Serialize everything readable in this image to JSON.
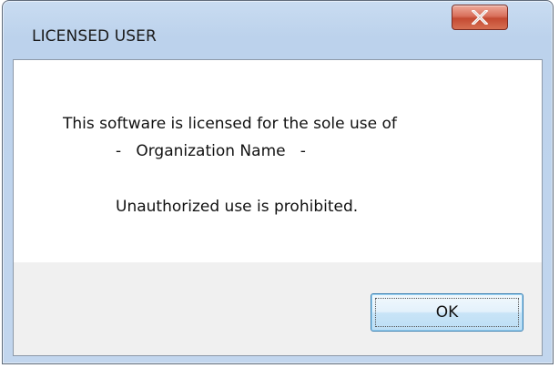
{
  "window": {
    "title": "LICENSED USER",
    "close_icon": "close-x-icon"
  },
  "message": {
    "line1": "This software is licensed for the sole use of",
    "line2": "-   Organization Name   -",
    "line3": "Unauthorized use is prohibited."
  },
  "buttons": {
    "ok_label": "OK"
  },
  "colors": {
    "close_button": "#c44a32",
    "title_bar": "#bcd2ec",
    "ok_button_border": "#3c7fb1"
  }
}
